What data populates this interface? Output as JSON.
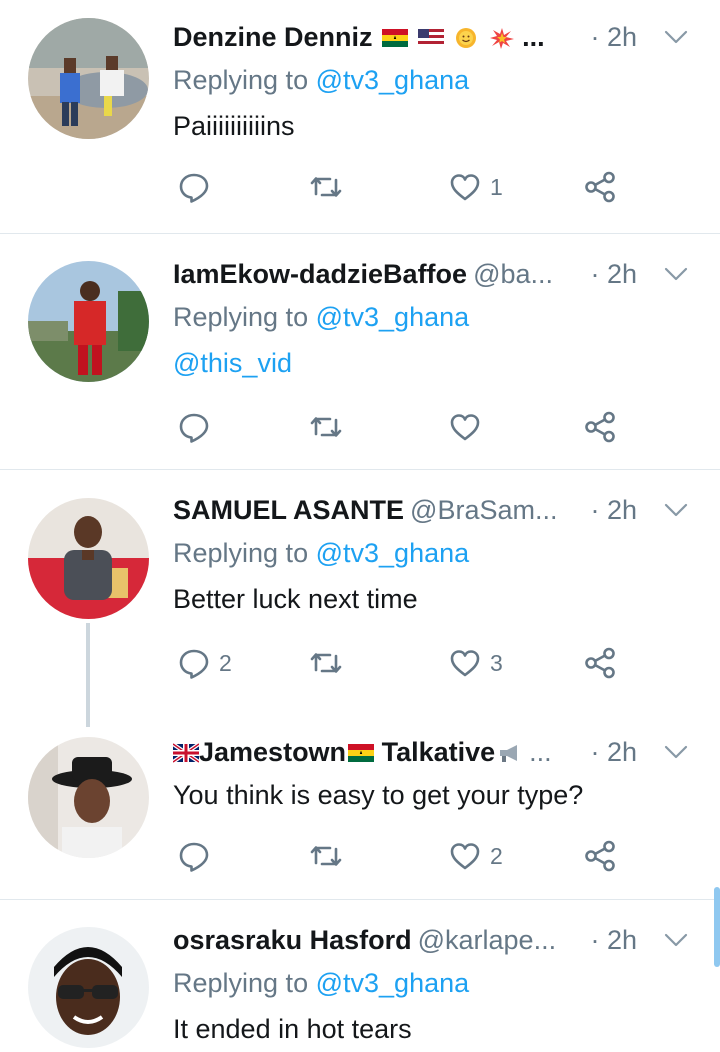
{
  "colors": {
    "accent": "#1da1f2",
    "secondary_text": "#657786",
    "primary_text": "#14171a",
    "divider": "#e1e8ed"
  },
  "tweets": [
    {
      "name": "Denzine Denniz",
      "handle": "",
      "name_suffix": "...",
      "time": "· 2h",
      "replying_label": "Replying to",
      "replying_to": "@tv3_ghana",
      "text": "Paiiiiiiiiiins",
      "reply_count": "",
      "retweet_count": "",
      "like_count": "1"
    },
    {
      "name": "IamEkow-dadzieBaffoe",
      "handle": "@ba...",
      "time": "· 2h",
      "replying_label": "Replying to",
      "replying_to": "@tv3_ghana",
      "text": "@this_vid",
      "reply_count": "",
      "retweet_count": "",
      "like_count": ""
    },
    {
      "name": "SAMUEL ASANTE",
      "handle": "@BraSam...",
      "time": "· 2h",
      "replying_label": "Replying to",
      "replying_to": "@tv3_ghana",
      "text": "Better luck next time",
      "reply_count": "2",
      "retweet_count": "",
      "like_count": "3"
    },
    {
      "name_part1": "Jamestown",
      "name_part2": "Talkative",
      "handle": "...",
      "time": "· 2h",
      "text": "You think is easy to get your type?",
      "reply_count": "",
      "retweet_count": "",
      "like_count": "2"
    },
    {
      "name": "osrasraku Hasford",
      "handle": "@karlape...",
      "time": "· 2h",
      "replying_label": "Replying to",
      "replying_to": "@tv3_ghana",
      "text": "It ended in hot tears"
    }
  ]
}
